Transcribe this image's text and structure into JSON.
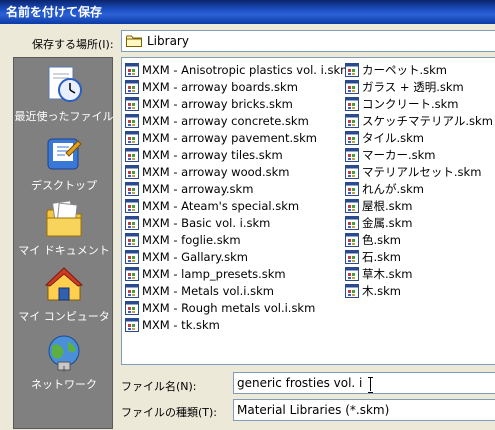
{
  "window": {
    "title": "名前を付けて保存"
  },
  "save_in": {
    "label": "保存する場所(I):",
    "value": "Library"
  },
  "places": [
    {
      "label": "最近使ったファイル",
      "icon": "recent-documents-icon"
    },
    {
      "label": "デスクトップ",
      "icon": "desktop-icon"
    },
    {
      "label": "マイ ドキュメント",
      "icon": "my-documents-icon"
    },
    {
      "label": "マイ コンピュータ",
      "icon": "my-computer-icon"
    },
    {
      "label": "ネットワーク",
      "icon": "network-icon"
    }
  ],
  "files_col1": [
    "MXM - Anisotropic plastics vol. i.skm",
    "MXM - arroway boards.skm",
    "MXM - arroway bricks.skm",
    "MXM - arroway concrete.skm",
    "MXM - arroway pavement.skm",
    "MXM - arroway tiles.skm",
    "MXM - arroway wood.skm",
    "MXM - arroway.skm",
    "MXM - Ateam's special.skm",
    "MXM - Basic vol. i.skm",
    "MXM - foglie.skm",
    "MXM - Gallary.skm",
    "MXM - lamp_presets.skm",
    "MXM - Metals vol.i.skm",
    "MXM - Rough metals vol.i.skm",
    "MXM - tk.skm"
  ],
  "files_col2": [
    "カーペット.skm",
    "ガラス + 透明.skm",
    "コンクリート.skm",
    "スケッチマテリアル.skm",
    "タイル.skm",
    "マーカー.skm",
    "マテリアルセット.skm",
    "れんが.skm",
    "屋根.skm",
    "金属.skm",
    "色.skm",
    "石.skm",
    "草木.skm",
    "木.skm"
  ],
  "file_name": {
    "label": "ファイル名(N):",
    "value": "generic frosties vol. i"
  },
  "file_type": {
    "label": "ファイルの種類(T):",
    "value": "Material Libraries (*.skm)"
  },
  "colors": {
    "title_bar": "#0a3fb0",
    "places_bar": "#808080",
    "dialog_bg": "#ece9d8",
    "border": "#7f9db9"
  }
}
